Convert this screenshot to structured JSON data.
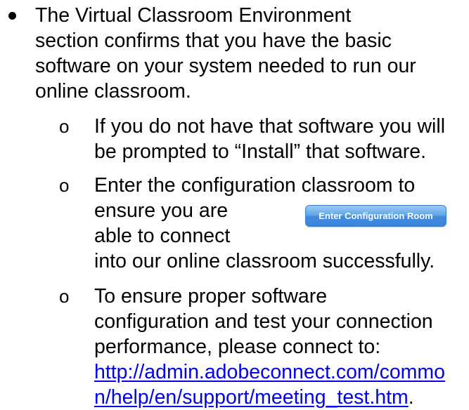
{
  "main_bullet": {
    "lines": [
      "The Virtual Classroom Environment",
      "section confirms that you have the basic",
      "software on your system needed to run our",
      "online classroom."
    ]
  },
  "sub_marker": "o",
  "sub_bullets": {
    "install": {
      "lines": [
        "If you do not have that software you will",
        "be prompted to “Install” that software."
      ]
    },
    "config": {
      "lines": [
        "Enter the configuration classroom to",
        "ensure you are",
        "able to connect",
        "into our online classroom successfully."
      ],
      "button_label": "Enter Configuration Room"
    },
    "test": {
      "lines": [
        "To ensure proper software",
        "configuration and test your connection",
        "performance, please connect to:"
      ],
      "link_lines": [
        "http://admin.adobeconnect.com/commo",
        "n/help/en/support/meeting_test.htm"
      ],
      "link_trailing": "."
    }
  },
  "colors": {
    "text": "#000000",
    "link": "#0000ee",
    "button_top": "#9fcbf5",
    "button_bottom": "#3b86dc"
  }
}
